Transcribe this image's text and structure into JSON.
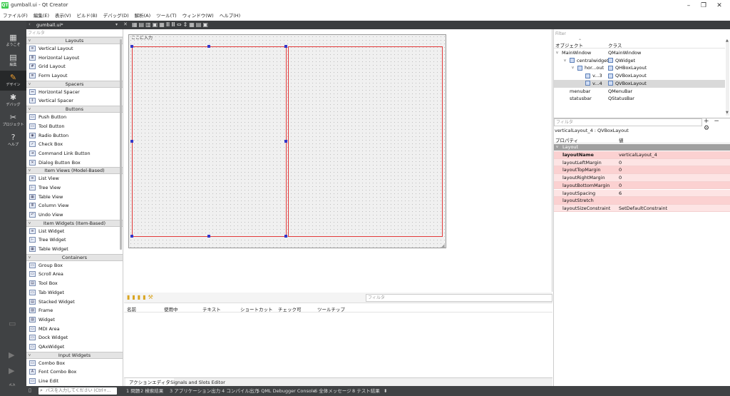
{
  "window": {
    "title": "gumball.ui - Qt Creator",
    "logo": "QT",
    "controls": [
      "–",
      "❐",
      "✕"
    ]
  },
  "menu": [
    "ファイル(F)",
    "編集(E)",
    "表示(V)",
    "ビルド(B)",
    "デバッグ(D)",
    "解析(A)",
    "ツール(T)",
    "ウィンドウ(W)",
    "ヘルプ(H)"
  ],
  "modes": [
    {
      "name": "welcome",
      "label": "ようこそ",
      "icon": "▦"
    },
    {
      "name": "edit",
      "label": "編集",
      "icon": "▤"
    },
    {
      "name": "design",
      "label": "デザイン",
      "icon": "✎"
    },
    {
      "name": "debug",
      "label": "デバッグ",
      "icon": "✱"
    },
    {
      "name": "project",
      "label": "プロジェクト",
      "icon": "✂"
    },
    {
      "name": "help",
      "label": "ヘルプ",
      "icon": "?"
    }
  ],
  "toolbar": {
    "file": "gumball.ui*",
    "close": "✕"
  },
  "widgetbox": {
    "filter_placeholder": "フィルタ",
    "groups": [
      {
        "title": "Layouts",
        "items": [
          {
            "label": "Vertical Layout",
            "icon": "≡"
          },
          {
            "label": "Horizontal Layout",
            "icon": "Ⅲ"
          },
          {
            "label": "Grid Layout",
            "icon": "#"
          },
          {
            "label": "Form Layout",
            "icon": "≣"
          }
        ]
      },
      {
        "title": "Spacers",
        "items": [
          {
            "label": "Horizontal Spacer",
            "icon": "⇔"
          },
          {
            "label": "Vertical Spacer",
            "icon": "⇕"
          }
        ]
      },
      {
        "title": "Buttons",
        "items": [
          {
            "label": "Push Button",
            "icon": "▭"
          },
          {
            "label": "Tool Button",
            "icon": "▭"
          },
          {
            "label": "Radio Button",
            "icon": "◉"
          },
          {
            "label": "Check Box",
            "icon": "✓"
          },
          {
            "label": "Command Link Button",
            "icon": "➜"
          },
          {
            "label": "Dialog Button Box",
            "icon": "✕"
          }
        ]
      },
      {
        "title": "Item Views (Model-Based)",
        "items": [
          {
            "label": "List View",
            "icon": "≡"
          },
          {
            "label": "Tree View",
            "icon": "⊢"
          },
          {
            "label": "Table View",
            "icon": "▦"
          },
          {
            "label": "Column View",
            "icon": "Ⅲ"
          },
          {
            "label": "Undo View",
            "icon": "↶"
          }
        ]
      },
      {
        "title": "Item Widgets (Item-Based)",
        "items": [
          {
            "label": "List Widget",
            "icon": "≡"
          },
          {
            "label": "Tree Widget",
            "icon": "⊢"
          },
          {
            "label": "Table Widget",
            "icon": "▦"
          }
        ]
      },
      {
        "title": "Containers",
        "items": [
          {
            "label": "Group Box",
            "icon": "▭"
          },
          {
            "label": "Scroll Area",
            "icon": "▭"
          },
          {
            "label": "Tool Box",
            "icon": "▤"
          },
          {
            "label": "Tab Widget",
            "icon": "▭"
          },
          {
            "label": "Stacked Widget",
            "icon": "▤"
          },
          {
            "label": "Frame",
            "icon": "▨"
          },
          {
            "label": "Widget",
            "icon": "▨"
          },
          {
            "label": "MDI Area",
            "icon": "▭"
          },
          {
            "label": "Dock Widget",
            "icon": "▭"
          },
          {
            "label": "QAxWidget",
            "icon": "▭"
          }
        ]
      },
      {
        "title": "Input Widgets",
        "items": [
          {
            "label": "Combo Box",
            "icon": "▭"
          },
          {
            "label": "Font Combo Box",
            "icon": "A"
          },
          {
            "label": "Line Edit",
            "icon": "▭"
          }
        ]
      }
    ]
  },
  "form": {
    "menu_placeholder": "ここに入力"
  },
  "action_editor": {
    "filter_placeholder": "フィルタ",
    "columns": [
      "名前",
      "使用中",
      "テキスト",
      "ショートカット",
      "チェック可",
      "ツールチップ"
    ],
    "tabs": [
      "アクションエディタ",
      "Signals and Slots Editor"
    ]
  },
  "object_inspector": {
    "filter_placeholder": "Filter",
    "col_object": "オブジェクト",
    "col_class": "クラス",
    "rows": [
      {
        "obj": "MainWindow",
        "cls": "QMainWindow",
        "indent": 0,
        "arrow": "v",
        "icon": false,
        "cls_icon": false
      },
      {
        "obj": "centralwidget",
        "cls": "QWidget",
        "indent": 1,
        "arrow": "v",
        "icon": true,
        "cls_icon": true
      },
      {
        "obj": "hor...out",
        "cls": "QHBoxLayout",
        "indent": 2,
        "arrow": "v",
        "icon": true,
        "cls_icon": true
      },
      {
        "obj": "v...3",
        "cls": "QVBoxLayout",
        "indent": 3,
        "arrow": "",
        "icon": true,
        "cls_icon": true
      },
      {
        "obj": "v...4",
        "cls": "QVBoxLayout",
        "indent": 3,
        "arrow": "",
        "icon": true,
        "cls_icon": true,
        "selected": true
      },
      {
        "obj": "menubar",
        "cls": "QMenuBar",
        "indent": 1,
        "arrow": "",
        "icon": false,
        "cls_icon": false
      },
      {
        "obj": "statusbar",
        "cls": "QStatusBar",
        "indent": 1,
        "arrow": "",
        "icon": false,
        "cls_icon": false
      }
    ]
  },
  "property_editor": {
    "filter_placeholder": "フィルタ",
    "tools": "+ − ⚙",
    "object_name": "verticalLayout_4 : QVBoxLayout",
    "col_property": "プロパティ",
    "col_value": "値",
    "group": "Layout",
    "rows": [
      {
        "name": "layoutName",
        "value": "verticalLayout_4",
        "bold": true
      },
      {
        "name": "layoutLeftMargin",
        "value": "0"
      },
      {
        "name": "layoutTopMargin",
        "value": "0"
      },
      {
        "name": "layoutRightMargin",
        "value": "0"
      },
      {
        "name": "layoutBottomMargin",
        "value": "0"
      },
      {
        "name": "layoutSpacing",
        "value": "6"
      },
      {
        "name": "layoutStretch",
        "value": ""
      },
      {
        "name": "layoutSizeConstraint",
        "value": "SetDefaultConstraint"
      }
    ],
    "row_colors": [
      "#fbd1d1",
      "#fde4e4"
    ]
  },
  "statusbar": {
    "search_placeholder": "パスを入力してください (Ctrl+...",
    "panes": [
      "1 問題",
      "2 検索結果",
      "3 アプリケーション出力",
      "4 コンパイル出力",
      "5 QML Debugger Console",
      "6 全体メッセージ",
      "8 テスト結果"
    ],
    "more": "⬍"
  },
  "colors": {
    "sidebar": "#404244",
    "layout_border": "#e23a3a",
    "handle": "#3535c8",
    "accent_orange": "#f0a030"
  }
}
